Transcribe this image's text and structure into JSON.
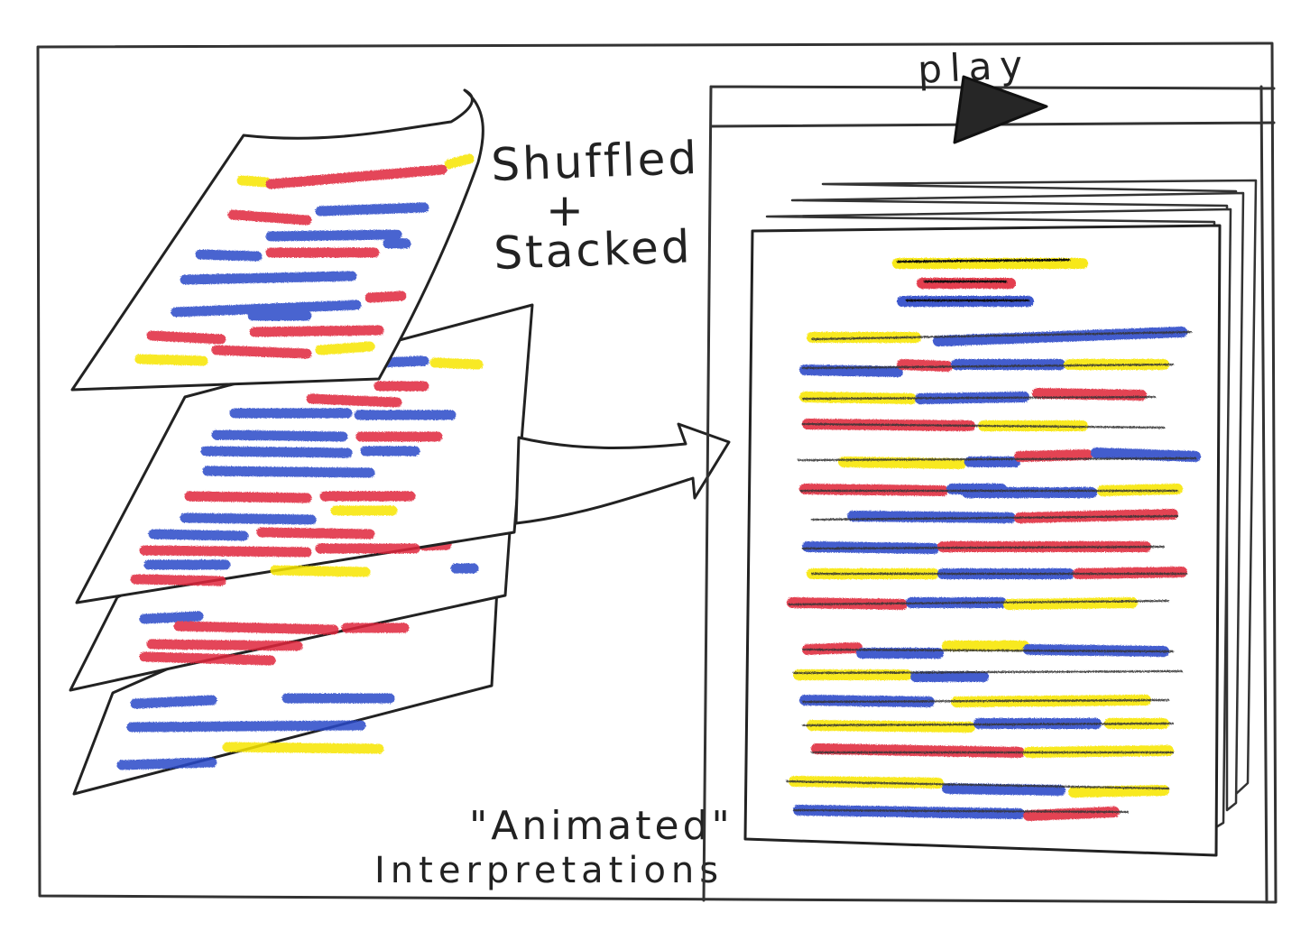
{
  "labels": {
    "stack_line1": "Shuffled",
    "stack_plus": "+",
    "stack_line2": "Stacked",
    "caption_line1": "\"Animated\"",
    "caption_line2": "Interpretations",
    "play": "play"
  },
  "colors": {
    "ink": "#222222",
    "red": "#e0283c",
    "blue": "#2a48c8",
    "yellow": "#f7e600",
    "paper": "#ffffff"
  },
  "icons": {
    "play": "play-triangle-icon",
    "flow": "right-arrow-icon"
  }
}
